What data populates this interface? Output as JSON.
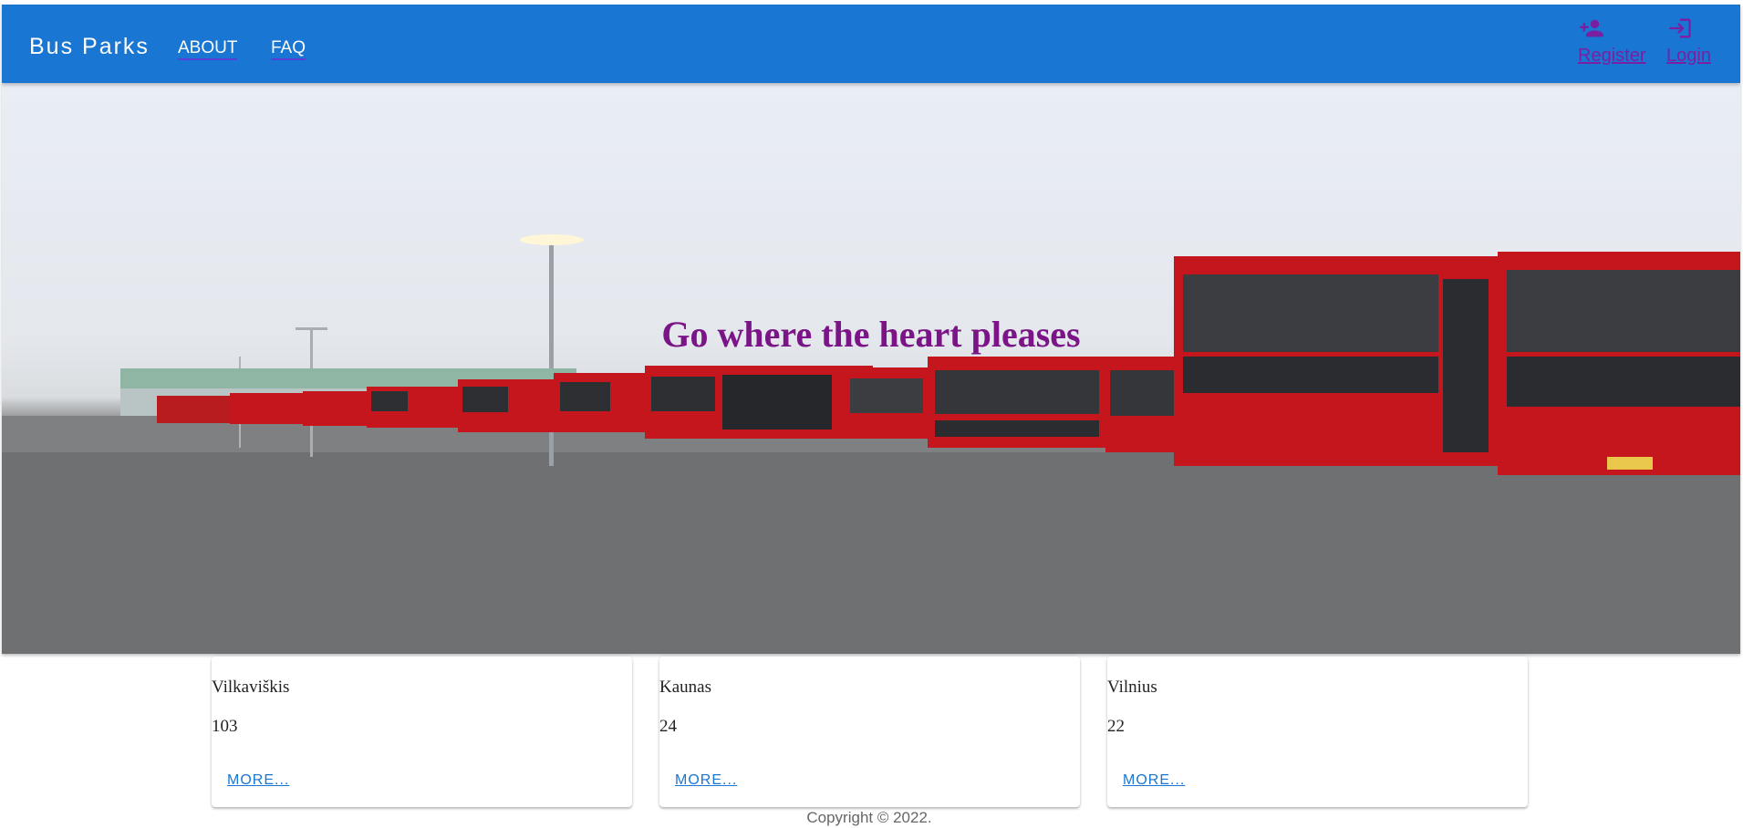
{
  "header": {
    "brand": "Bus Parks",
    "nav": [
      {
        "label": "ABOUT"
      },
      {
        "label": "FAQ"
      }
    ],
    "auth": [
      {
        "label": "Register",
        "icon": "person-add-icon"
      },
      {
        "label": "Login",
        "icon": "login-icon"
      }
    ]
  },
  "hero": {
    "title": "Go where the heart pleases",
    "image": "bus-depot-photo"
  },
  "cards": [
    {
      "name": "Vilkaviškis",
      "count": "103",
      "more": "MORE..."
    },
    {
      "name": "Kaunas",
      "count": "24",
      "more": "MORE..."
    },
    {
      "name": "Vilnius",
      "count": "22",
      "more": "MORE..."
    }
  ],
  "footer": {
    "copyright": "Copyright © 2022."
  },
  "colors": {
    "appbar": "#1976d2",
    "hero_title": "#7b1587",
    "auth_links": "#7b1fa2",
    "more_link": "#1976d2",
    "bus_red": "#c4161c"
  }
}
